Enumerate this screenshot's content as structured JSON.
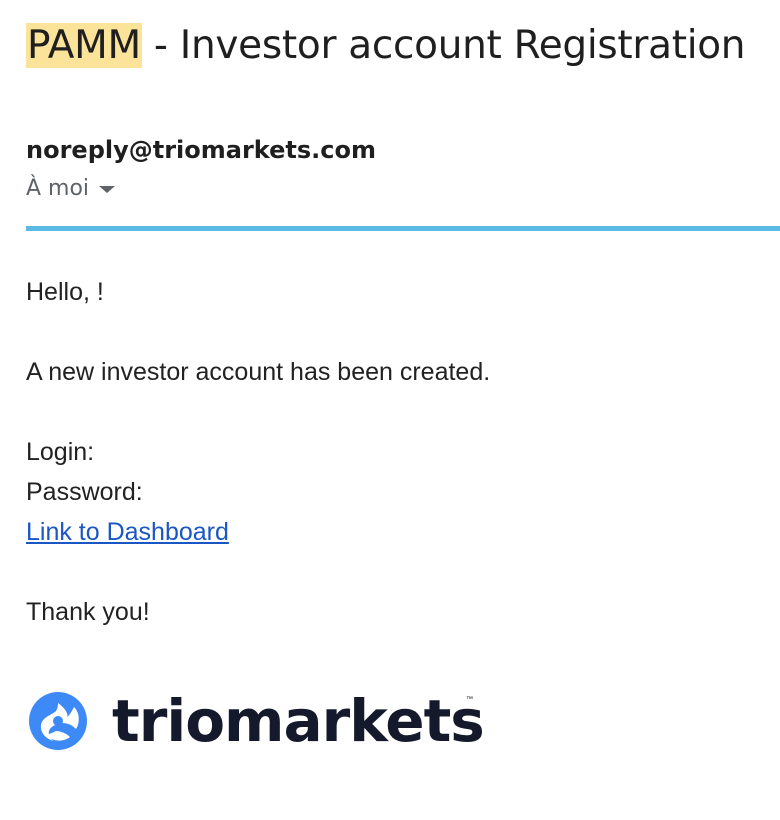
{
  "email": {
    "subject_highlight": "PAMM",
    "subject_rest": " - Investor account Registration",
    "sender": "noreply@triomarkets.com",
    "recipient": "À moi",
    "body": {
      "greeting": "Hello, !",
      "message": "A new investor account has been created.",
      "login_label": "Login:",
      "password_label": "Password:",
      "link_text": "Link to Dashboard",
      "closing": "Thank you!"
    },
    "footer_logo": {
      "name": "triomarkets",
      "trademark": "™",
      "icon": "triomarkets-logo-icon",
      "brand_color": "#3d8af7"
    }
  },
  "colors": {
    "highlight": "#fbe39a",
    "divider": "#5bb9e3",
    "link": "#1a56c4"
  }
}
